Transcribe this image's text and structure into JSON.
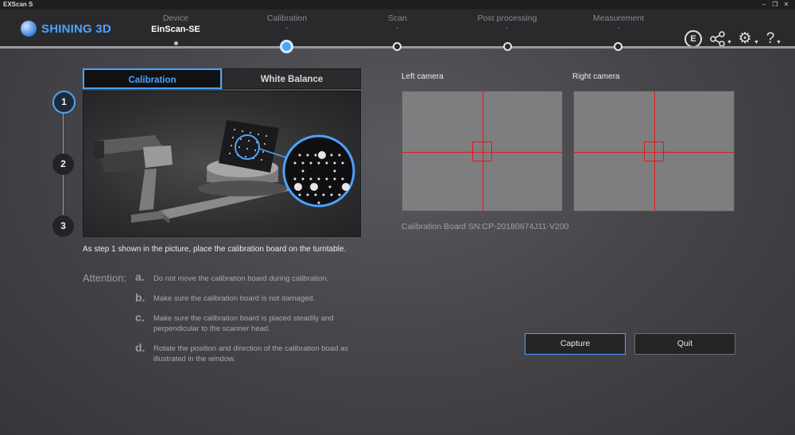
{
  "window": {
    "title": "EXScan S"
  },
  "logo": {
    "text": "SHINING 3D"
  },
  "steps": [
    {
      "name": "Device",
      "value": "EinScan-SE"
    },
    {
      "name": "Calibration",
      "value": "-"
    },
    {
      "name": "Scan",
      "value": "-"
    },
    {
      "name": "Post processing",
      "value": "-"
    },
    {
      "name": "Measurement",
      "value": "-"
    }
  ],
  "header_icons": {
    "ecircle_text": "E"
  },
  "calibration_steps": [
    "1",
    "2",
    "3"
  ],
  "tabs": {
    "calibration": "Calibration",
    "white_balance": "White Balance"
  },
  "instruction": "As step 1 shown in the picture, place the calibration board on the turntable.",
  "attention": {
    "label": "Attention:",
    "items": [
      {
        "bullet": "a.",
        "text": "Do not move the calibration board during calibration."
      },
      {
        "bullet": "b.",
        "text": "Make sure the calibration board is not damaged."
      },
      {
        "bullet": "c.",
        "text": "Make sure the calibration board is placed steadily and perpendicular to the scanner head."
      },
      {
        "bullet": "d.",
        "text": "Rotate the position and direction of the calibration boad as illustrated in the window."
      }
    ]
  },
  "cameras": {
    "left": "Left camera",
    "right": "Right camera"
  },
  "calibration_board_sn": "Calibration Board SN:CP-20180674J11-V200",
  "buttons": {
    "capture": "Capture",
    "quit": "Quit"
  },
  "colors": {
    "accent": "#4aa3ff",
    "crosshair": "#e01818",
    "background": "#47474b"
  }
}
